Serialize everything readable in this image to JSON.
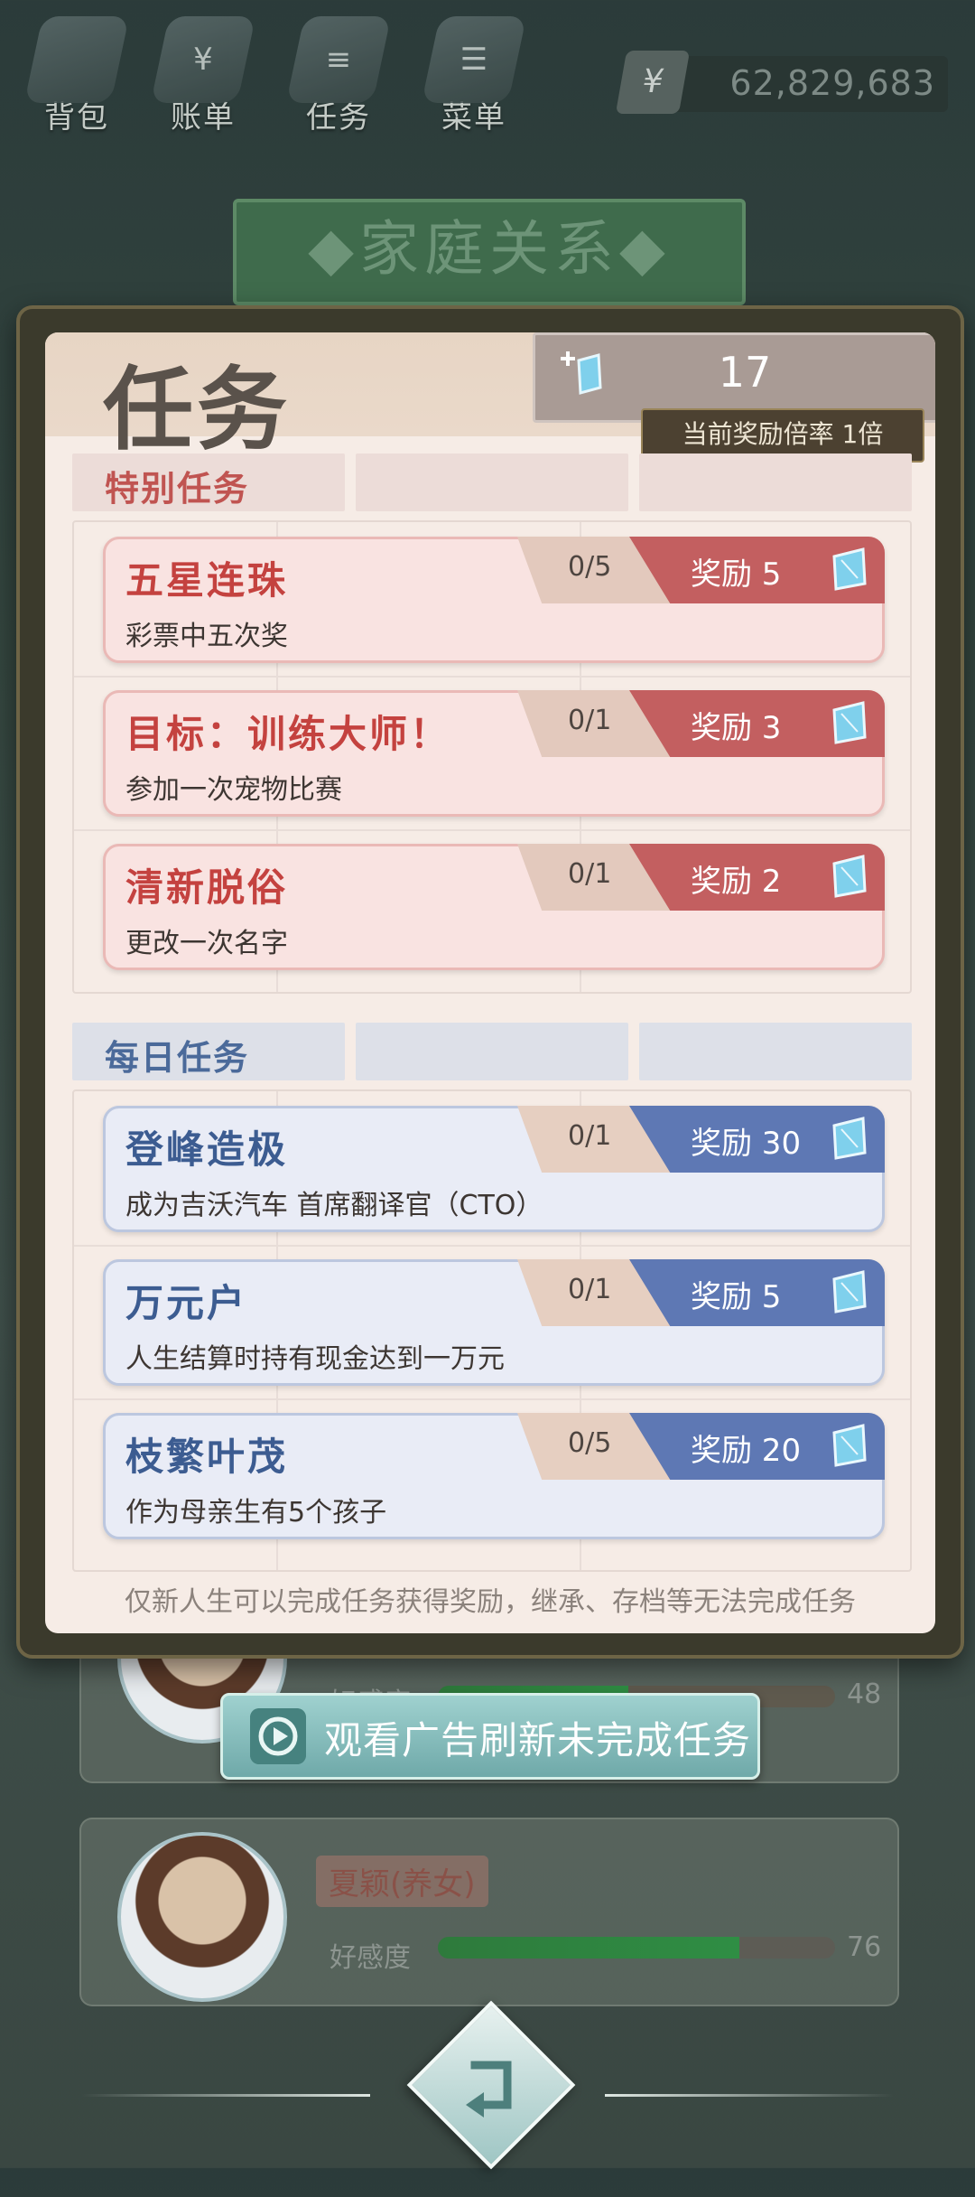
{
  "topnav": [
    {
      "label": "背包",
      "icon": "backpack-icon",
      "glyph": ""
    },
    {
      "label": "账单",
      "icon": "bill-icon",
      "glyph": "¥"
    },
    {
      "label": "任务",
      "icon": "task-icon",
      "glyph": "≡"
    },
    {
      "label": "菜单",
      "icon": "menu-icon",
      "glyph": "☰"
    }
  ],
  "money": {
    "symbol": "¥",
    "amount": "62,829,683"
  },
  "banner": {
    "title": "◆家庭关系◆"
  },
  "panel": {
    "title": "任务",
    "gems": "17",
    "rate_label": "当前奖励倍率 1倍",
    "footnote": "仅新人生可以完成任务获得奖励，继承、存档等无法完成任务"
  },
  "special": {
    "header": "特别任务",
    "tasks": [
      {
        "name": "五星连珠",
        "desc": "彩票中五次奖",
        "progress": "0/5",
        "reward": "奖励 5"
      },
      {
        "name": "目标：训练大师！",
        "desc": "参加一次宠物比赛",
        "progress": "0/1",
        "reward": "奖励 3"
      },
      {
        "name": "清新脱俗",
        "desc": "更改一次名字",
        "progress": "0/1",
        "reward": "奖励 2"
      }
    ]
  },
  "daily": {
    "header": "每日任务",
    "tasks": [
      {
        "name": "登峰造极",
        "desc": "成为吉沃汽车 首席翻译官（CTO）",
        "progress": "0/1",
        "reward": "奖励 30"
      },
      {
        "name": "万元户",
        "desc": "人生结算时持有现金达到一万元",
        "progress": "0/1",
        "reward": "奖励 5"
      },
      {
        "name": "枝繁叶茂",
        "desc": "作为母亲生有5个孩子",
        "progress": "0/5",
        "reward": "奖励 20"
      }
    ]
  },
  "ad_button": {
    "label": "观看广告刷新未完成任务"
  },
  "background_cards": [
    {
      "name": "",
      "favor_label": "好感度",
      "favor": 48,
      "favor_text": "48"
    },
    {
      "name": "夏颖(养女)",
      "favor_label": "好感度",
      "favor": 76,
      "favor_text": "76"
    }
  ],
  "colors": {
    "special_accent": "#c35f60",
    "daily_accent": "#5e78b4",
    "gem": "#5ab4d8"
  }
}
